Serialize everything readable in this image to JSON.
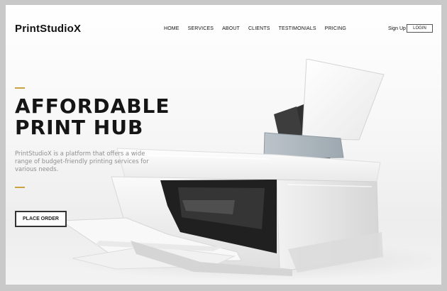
{
  "brand": {
    "name": "PrintStudioX"
  },
  "nav": {
    "items": [
      "HOME",
      "SERVICES",
      "ABOUT",
      "CLIENTS",
      "TESTIMONIALS",
      "PRICING"
    ]
  },
  "auth": {
    "sign_up_label": "Sign Up",
    "login_label": "LOGIN"
  },
  "hero": {
    "headline_line_1": "AFFORDABLE",
    "headline_line_2": "PRINT HUB",
    "description": "PrintStudioX is a platform that offers a wide range of budget-friendly printing services for various needs.",
    "cta_label": "PLACE ORDER"
  },
  "colors": {
    "accent": "#caa240",
    "page_background": "#f7f7f7",
    "text_primary": "#151515",
    "text_muted": "#8f8f8f",
    "frame": "#c9c9c9"
  },
  "icons": {
    "hero_image": "printer-image"
  }
}
